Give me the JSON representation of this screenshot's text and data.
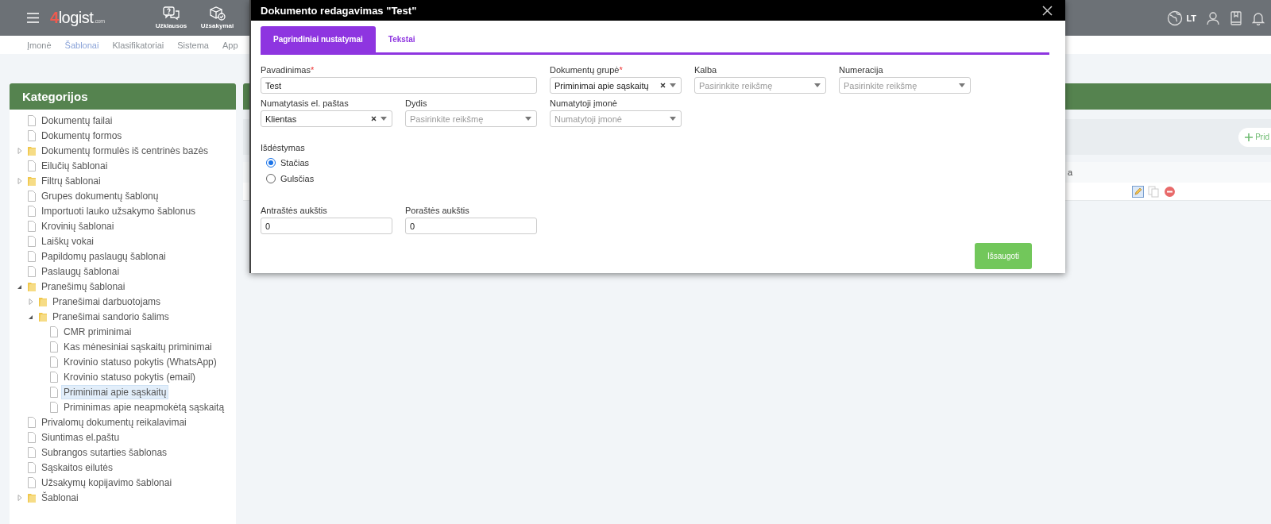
{
  "topbar": {
    "logo": {
      "digit": "4",
      "name": "logist",
      "domain": ".com"
    },
    "nav": [
      {
        "kind": "requests",
        "label": "Užklausos"
      },
      {
        "kind": "orders",
        "label": "Užsakymai"
      }
    ],
    "language": "LT"
  },
  "subnav": [
    {
      "label": "Įmonė",
      "selected": false
    },
    {
      "label": "Šablonai",
      "selected": true
    },
    {
      "label": "Klasifikatoriai",
      "selected": false
    },
    {
      "label": "Sistema",
      "selected": false
    },
    {
      "label": "App",
      "selected": false
    }
  ],
  "sidebar": {
    "title": "Kategorijos",
    "items": [
      {
        "kind": "file",
        "label": "Dokumentų failai",
        "selected": false
      },
      {
        "kind": "file",
        "label": "Dokumentų formos",
        "selected": false
      },
      {
        "kind": "folder",
        "label": "Dokumentų formulės iš centrinės bazės",
        "selected": false,
        "expanded": false
      },
      {
        "kind": "file",
        "label": "Eilučių šablonai",
        "selected": false
      },
      {
        "kind": "folder",
        "label": "Filtrų šablonai",
        "selected": false,
        "expanded": false
      },
      {
        "kind": "file",
        "label": "Grupes dokumentų šablonų",
        "selected": false
      },
      {
        "kind": "file",
        "label": "Importuoti lauko užsakymo šablonus",
        "selected": false
      },
      {
        "kind": "file",
        "label": "Krovinių šablonai",
        "selected": false
      },
      {
        "kind": "file",
        "label": "Laiškų vokai",
        "selected": false
      },
      {
        "kind": "file",
        "label": "Papildomų paslaugų šablonai",
        "selected": false
      },
      {
        "kind": "file",
        "label": "Paslaugų šablonai",
        "selected": false
      },
      {
        "kind": "folder",
        "label": "Pranešimų šablonai",
        "selected": false,
        "expanded": true,
        "children": [
          {
            "kind": "folder",
            "label": "Pranešimai darbuotojams",
            "selected": false,
            "expanded": false
          },
          {
            "kind": "folder",
            "label": "Pranešimai sandorio šalims",
            "selected": false,
            "expanded": true,
            "children": [
              {
                "kind": "file",
                "label": "CMR priminimai",
                "selected": false
              },
              {
                "kind": "file",
                "label": "Kas mėnesiniai sąskaitų priminimai",
                "selected": false
              },
              {
                "kind": "file",
                "label": "Krovinio statuso pokytis (WhatsApp)",
                "selected": false
              },
              {
                "kind": "file",
                "label": "Krovinio statuso pokytis (email)",
                "selected": false
              },
              {
                "kind": "file",
                "label": "Priminimai apie sąskaitų",
                "selected": true
              },
              {
                "kind": "file",
                "label": "Priminimas apie neapmokėtą sąskaitą",
                "selected": false
              }
            ]
          }
        ]
      },
      {
        "kind": "file",
        "label": "Privalomų dokumentų reikalavimai",
        "selected": false
      },
      {
        "kind": "file",
        "label": "Siuntimas el.paštu",
        "selected": false
      },
      {
        "kind": "file",
        "label": "Subrangos sutarties šablonas",
        "selected": false
      },
      {
        "kind": "file",
        "label": "Sąskaitos eilutės",
        "selected": false
      },
      {
        "kind": "file",
        "label": "Užsakymų kopijavimo šablonai",
        "selected": false
      },
      {
        "kind": "folder",
        "label": "Šablonai",
        "selected": false,
        "expanded": false
      }
    ]
  },
  "main_panel": {
    "add_button": "Prid",
    "column_fragment": "a"
  },
  "dialog": {
    "title": "Dokumento redagavimas \"Test\"",
    "tabs": [
      {
        "label": "Pagrindiniai nustatymai",
        "selected": true
      },
      {
        "label": "Tekstai",
        "selected": false
      }
    ],
    "field_rows": [
      [
        {
          "kind": "text",
          "label": "Pavadinimas",
          "required_mark": "*",
          "value": "Test"
        },
        {
          "kind": "select",
          "label": "Dokumentų grupė",
          "required_mark": "*",
          "value": "Priminimai apie sąskaitų",
          "clearable": true
        },
        {
          "kind": "select",
          "label": "Kalba",
          "placeholder": "Pasirinkite reikšmę",
          "clearable": false
        },
        {
          "kind": "select",
          "label": "Numeracija",
          "placeholder": "Pasirinkite reikšmę",
          "clearable": false
        }
      ],
      [
        {
          "kind": "select",
          "label": "Numatytasis el. paštas",
          "value": "Klientas",
          "clearable": true
        },
        {
          "kind": "select",
          "label": "Dydis",
          "placeholder": "Pasirinkite reikšmę",
          "clearable": false
        },
        {
          "kind": "select",
          "label": "Numatytoji įmonė",
          "placeholder": "Numatytoji įmonė",
          "clearable": false
        }
      ]
    ],
    "layout": {
      "label": "Išdėstymas",
      "options": [
        {
          "label": "Stačias",
          "selected": true
        },
        {
          "label": "Gulsčias",
          "selected": false
        }
      ]
    },
    "height_fields": [
      {
        "kind": "text",
        "label": "Antraštės aukštis",
        "value": "0"
      },
      {
        "kind": "text",
        "label": "Poraštės aukštis",
        "value": "0"
      }
    ],
    "save_button": "Išsaugoti"
  }
}
